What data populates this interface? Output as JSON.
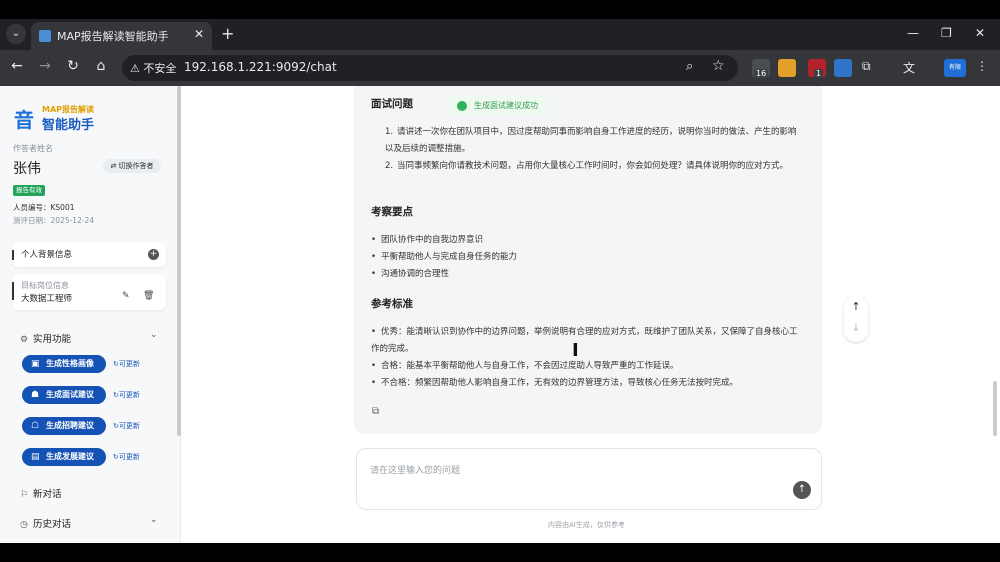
{
  "browser": {
    "tab_title": "MAP报告解读智能助手",
    "security_label": "不安全",
    "url": "192.168.1.221:9092/chat",
    "ext_badge_1": "16",
    "ext_badge_2": "1",
    "profile_label": "有限"
  },
  "sidebar": {
    "logo_small": "MAP报告解读",
    "logo_main": "智能助手",
    "respondent_label": "作答者姓名",
    "respondent_name": "张伟",
    "switch_label": "切换作答者",
    "report_status": "报告有效",
    "staff_id": "人员编号：KS001",
    "test_date": "测评日期：2025-12-24",
    "personal_info": "个人背景信息",
    "target_label": "目标岗位信息",
    "target_value": "大数据工程师",
    "functions_title": "实用功能",
    "functions": [
      {
        "label": "生成性格画像",
        "refresh": "可更新"
      },
      {
        "label": "生成面试建议",
        "refresh": "可更新"
      },
      {
        "label": "生成招聘建议",
        "refresh": "可更新"
      },
      {
        "label": "生成发展建议",
        "refresh": "可更新"
      }
    ],
    "new_chat": "新对话",
    "history": "历史对话"
  },
  "chat": {
    "toast": "生成面试建议成功",
    "sections": {
      "interview_title": "面试问题",
      "questions": [
        {
          "n": "1.",
          "text": "请讲述一次你在团队项目中，因过度帮助同事而影响自身工作进度的经历，说明你当时的做法、产生的影响以及后续的调整措施。"
        },
        {
          "n": "2.",
          "text": "当同事频繁向你请教技术问题，占用你大量核心工作时间时，你会如何处理？请具体说明你的应对方式。"
        }
      ],
      "focus_title": "考察要点",
      "focus": [
        "团队协作中的自我边界意识",
        "平衡帮助他人与完成自身任务的能力",
        "沟通协调的合理性"
      ],
      "criteria_title": "参考标准",
      "criteria": [
        "优秀：能清晰认识到协作中的边界问题，举例说明有合理的应对方式，既维护了团队关系，又保障了自身核心工作的完成。",
        "合格：能基本平衡帮助他人与自身工作，不会因过度助人导致严重的工作延误。",
        "不合格：频繁因帮助他人影响自身工作，无有效的边界管理方法，导致核心任务无法按时完成。"
      ]
    },
    "input_placeholder": "请在这里输入您的问题",
    "footer": "内容由AI生成，仅供参考"
  }
}
